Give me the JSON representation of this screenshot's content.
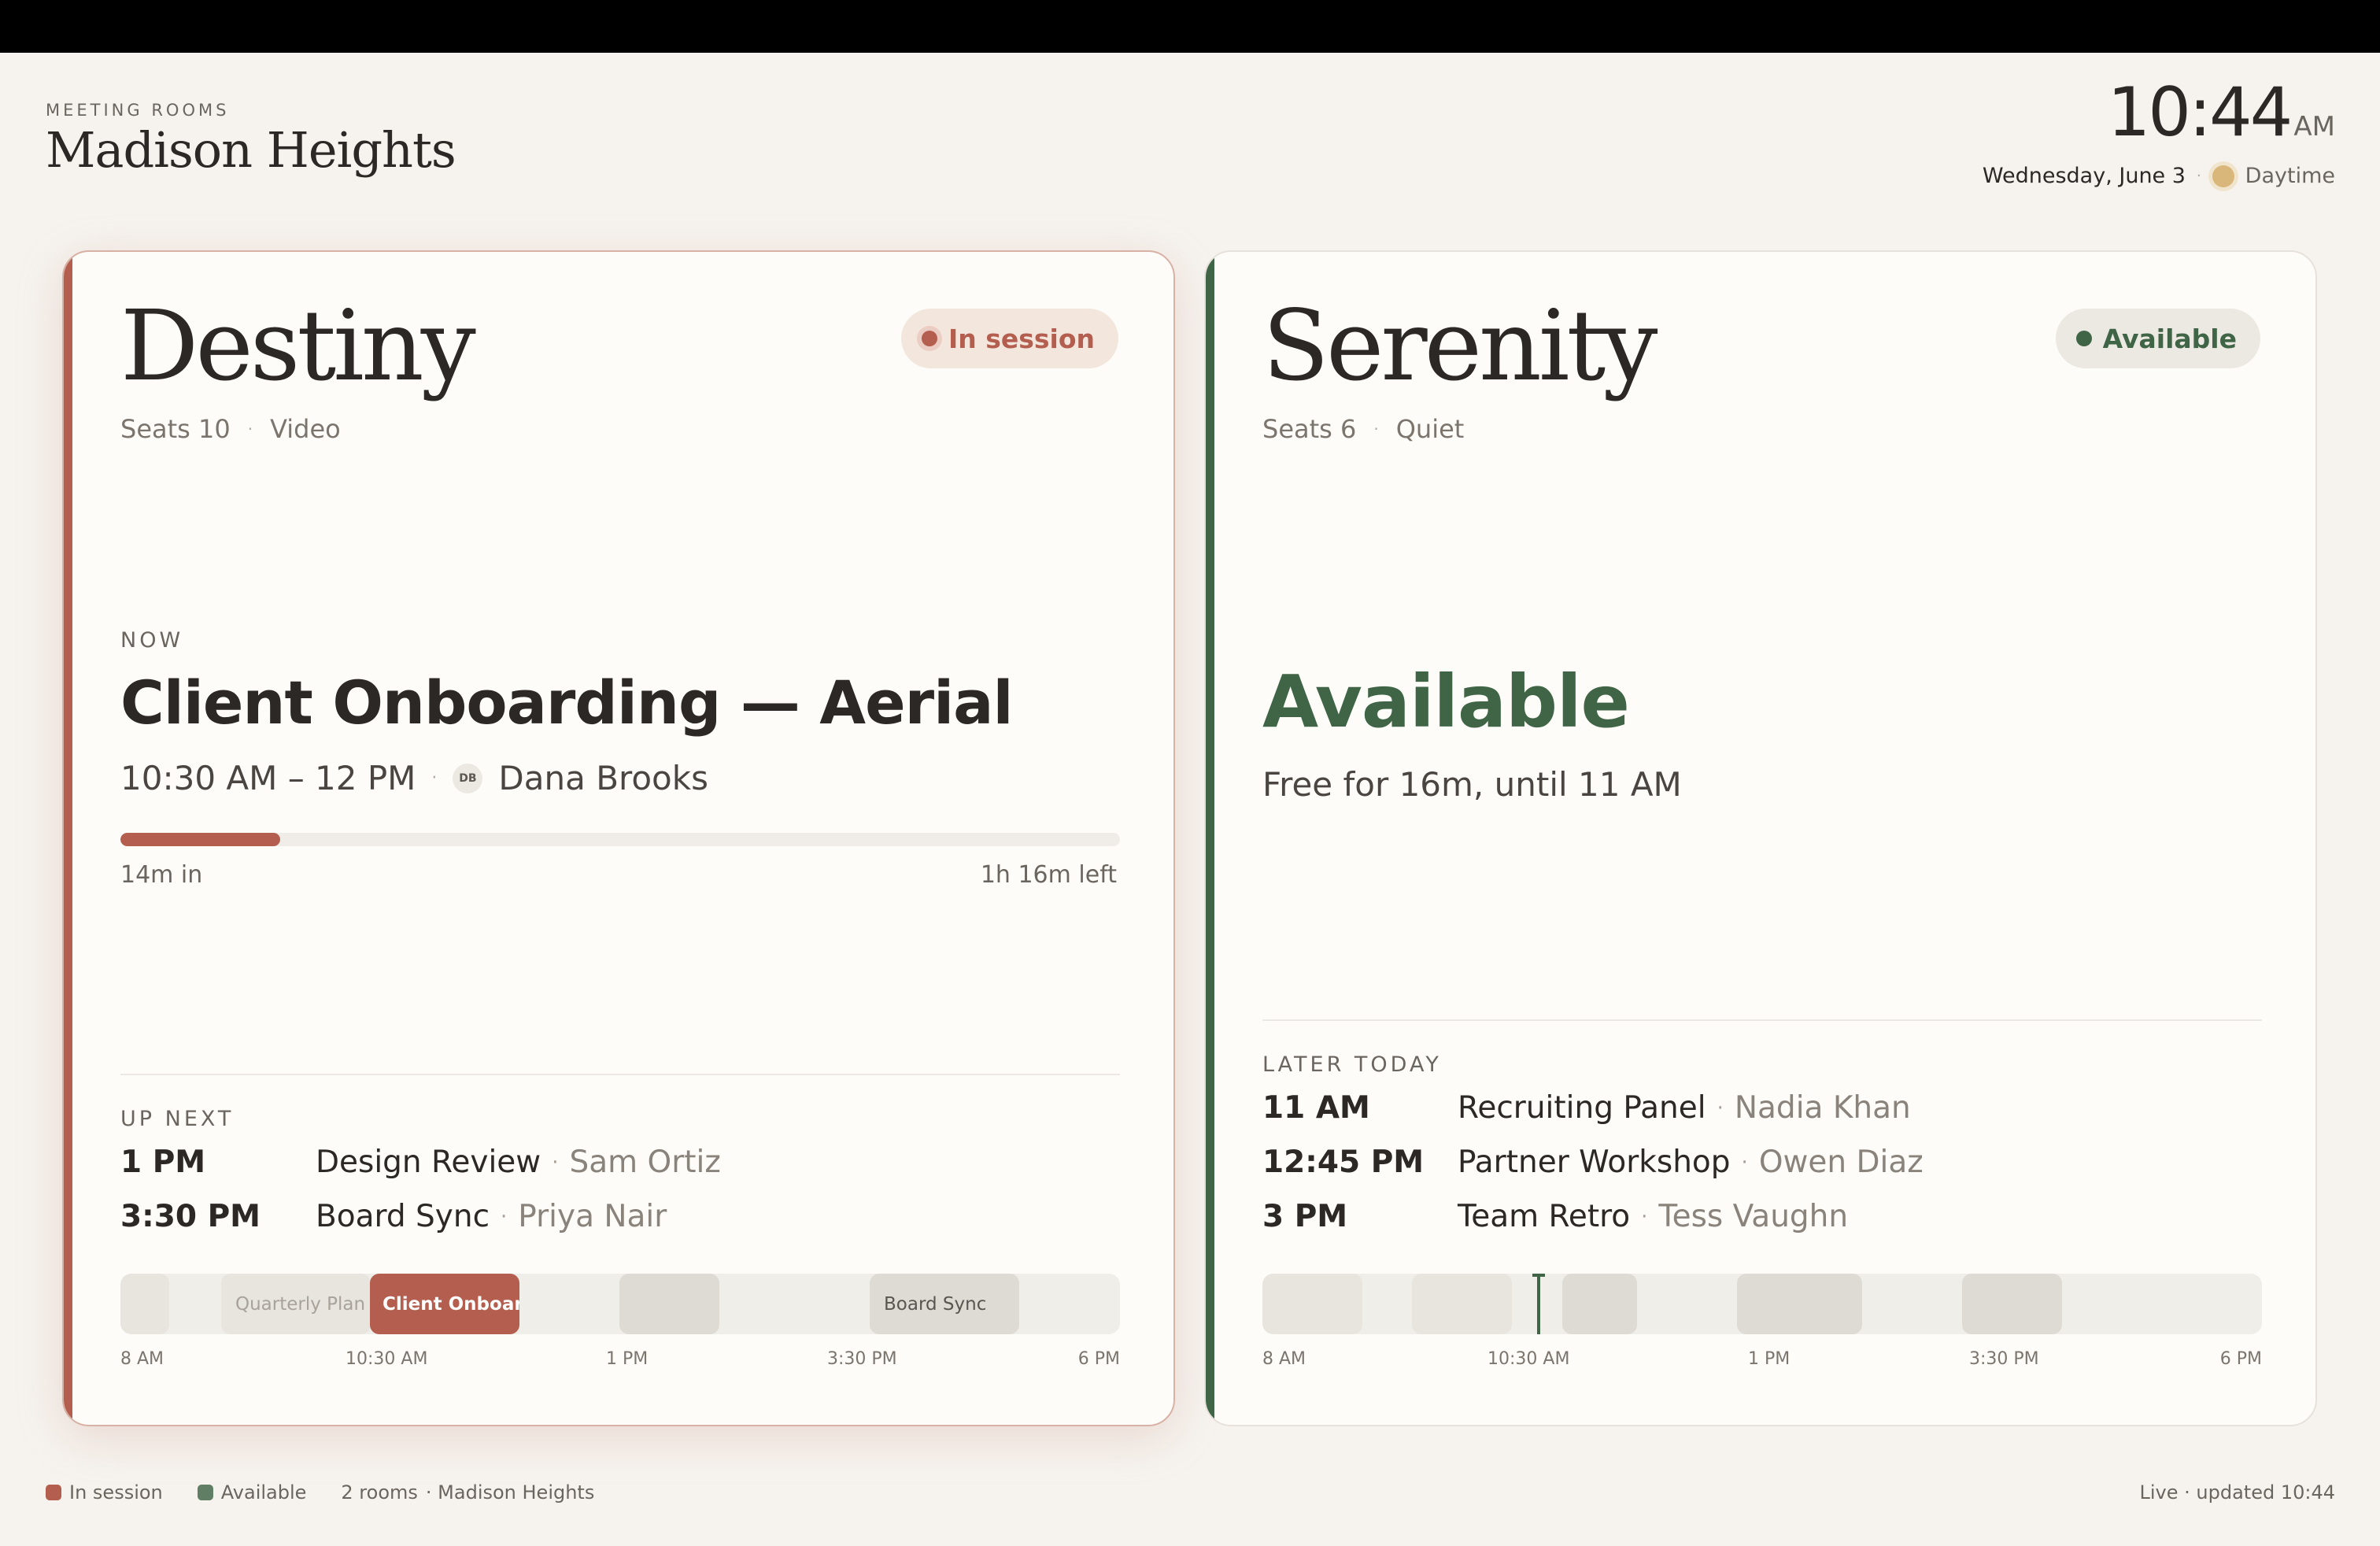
{
  "header": {
    "kicker": "MEETING ROOMS",
    "location": "Madison Heights",
    "time": "10:44",
    "ampm": "AM",
    "date": "Wednesday, June 3",
    "daytime_label": "Daytime"
  },
  "colors": {
    "busy": "#b45e4f",
    "available": "#3f6546",
    "background": "#f6f3ef",
    "card": "#fefcf8"
  },
  "rooms": [
    {
      "name": "Destiny",
      "seats": "Seats 10",
      "feature": "Video",
      "status": "In session",
      "now": {
        "kicker": "NOW",
        "title": "Client Onboarding — Aerial",
        "time": "10:30 AM – 12 PM",
        "host_initials": "DB",
        "host": "Dana Brooks",
        "progress": 0.16,
        "elapsed": "14m in",
        "remaining": "1h 16m left"
      },
      "schedule_kicker": "UP NEXT",
      "schedule": [
        {
          "time": "1 PM",
          "title": "Design Review",
          "host": "Sam Ortiz"
        },
        {
          "time": "3:30 PM",
          "title": "Board Sync",
          "host": "Priya Nair"
        }
      ],
      "timeline": {
        "blocks": [
          {
            "label": "Quarterly Plan",
            "state": "past"
          },
          {
            "label": "Client Onboarding",
            "state": "current"
          },
          {
            "label": "Board Sync",
            "state": "future"
          }
        ],
        "ticks": [
          "8 AM",
          "10:30 AM",
          "1 PM",
          "3:30 PM",
          "6 PM"
        ]
      }
    },
    {
      "name": "Serenity",
      "seats": "Seats 6",
      "feature": "Quiet",
      "status": "Available",
      "available": {
        "title": "Available",
        "subtitle": "Free for 16m, until 11 AM"
      },
      "schedule_kicker": "LATER TODAY",
      "schedule": [
        {
          "time": "11 AM",
          "title": "Recruiting Panel",
          "host": "Nadia Khan"
        },
        {
          "time": "12:45 PM",
          "title": "Partner Workshop",
          "host": "Owen Diaz"
        },
        {
          "time": "3 PM",
          "title": "Team Retro",
          "host": "Tess Vaughn"
        }
      ],
      "timeline": {
        "ticks": [
          "8 AM",
          "10:30 AM",
          "1 PM",
          "3:30 PM",
          "6 PM"
        ]
      }
    }
  ],
  "footer": {
    "legend_busy": "In session",
    "legend_available": "Available",
    "rooms_count": "2 rooms",
    "location": "· Madison Heights",
    "status": "Live · updated 10:44"
  }
}
